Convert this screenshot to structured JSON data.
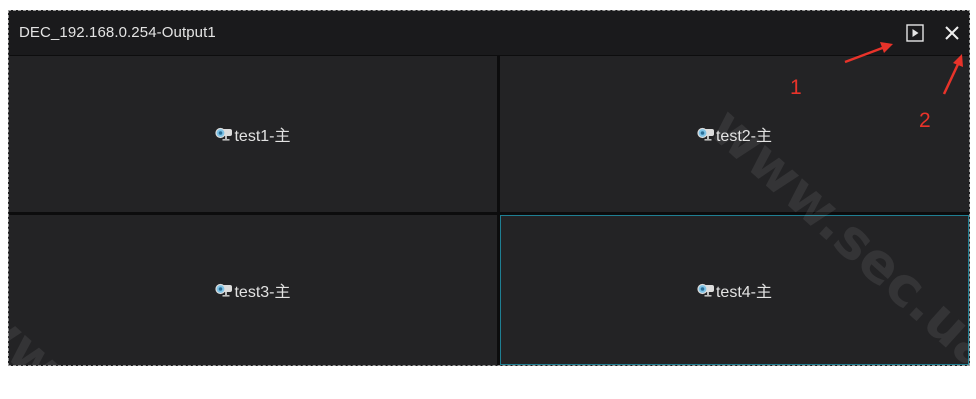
{
  "window": {
    "title": "DEC_192.168.0.254-Output1",
    "play_icon": "play-icon",
    "close_icon": "close-icon"
  },
  "cells": [
    {
      "label": "test1-主",
      "icon": "camera-icon"
    },
    {
      "label": "test2-主",
      "icon": "camera-icon"
    },
    {
      "label": "test3-主",
      "icon": "camera-icon"
    },
    {
      "label": "test4-主",
      "icon": "camera-icon",
      "selected": true
    }
  ],
  "annotations": {
    "marker_1": "1",
    "marker_2": "2",
    "color": "#e8332a"
  },
  "watermark": {
    "text_top": "www.sec.ua",
    "text_bottom": "ww"
  },
  "colors": {
    "background": "#1c1c1e",
    "cell": "#232325",
    "selected_border": "#1f7f93",
    "text": "#e2e2e2"
  }
}
